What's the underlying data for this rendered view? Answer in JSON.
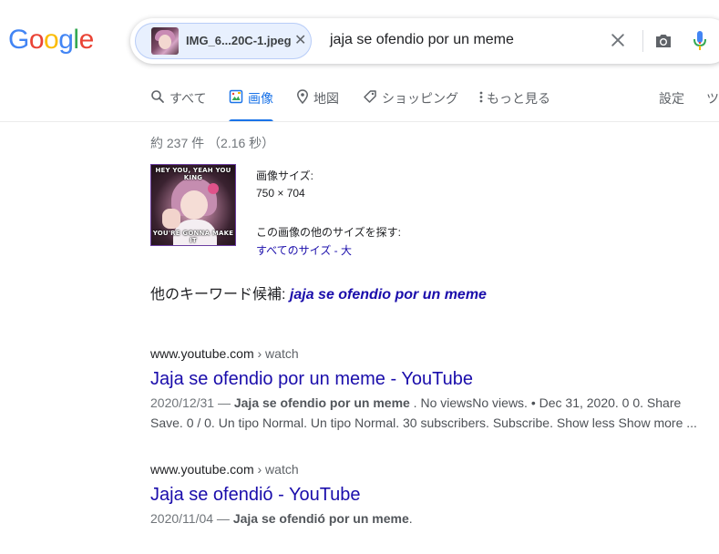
{
  "logo": {
    "letters": [
      "G",
      "o",
      "o",
      "g",
      "l",
      "e"
    ],
    "colors": [
      "#4285f4",
      "#ea4335",
      "#fbbc05",
      "#4285f4",
      "#34a853",
      "#ea4335"
    ]
  },
  "search": {
    "chip_label": "IMG_6...20C-1.jpeg",
    "query": "jaja se ofendio por un meme",
    "icons": {
      "chip_close": "close-icon",
      "clear": "clear-icon",
      "camera": "camera-icon",
      "mic": "mic-icon"
    }
  },
  "tabs": [
    {
      "label": "すべて",
      "icon": "search-icon"
    },
    {
      "label": "画像",
      "icon": "image-icon",
      "active": true
    },
    {
      "label": "地図",
      "icon": "map-pin-icon"
    },
    {
      "label": "ショッピング",
      "icon": "tag-icon"
    },
    {
      "label": "もっと見る",
      "icon": "more-vert-icon"
    },
    {
      "label": "設定"
    },
    {
      "label": "ツ"
    }
  ],
  "stats": "約 237 件 （2.16 秒）",
  "image": {
    "caption_top": "HEY YOU, YEAH YOU KING",
    "caption_bottom": "YOU'RE GONNA MAKE IT",
    "size_label": "画像サイズ:",
    "size_value": "750 × 704",
    "other_sizes_label": "この画像の他のサイズを探す:",
    "other_sizes_link": "すべてのサイズ - 大"
  },
  "suggestion": {
    "label": "他のキーワード候補: ",
    "keyword": "jaja se ofendio por un meme"
  },
  "results": [
    {
      "domain": "www.youtube.com",
      "crumb": " › watch",
      "title": "Jaja se ofendio por un meme - YouTube",
      "date": "2020/12/31 — ",
      "bold": "Jaja se ofendio por un meme",
      "line1_rest": " . No viewsNo views. • Dec 31, 2020. 0 0. Share",
      "line2": "Save. 0 / 0. Un tipo Normal. Un tipo Normal. 30 subscribers. Subscribe. Show less Show more ..."
    },
    {
      "domain": "www.youtube.com",
      "crumb": " › watch",
      "title": "Jaja se ofendió - YouTube",
      "date": "2020/11/04 — ",
      "bold": "Jaja se ofendió por un meme",
      "line1_rest": "."
    }
  ],
  "colors": {
    "link": "#1a0dab",
    "accent": "#1a73e8",
    "chip_bg": "#e8f0fe"
  }
}
